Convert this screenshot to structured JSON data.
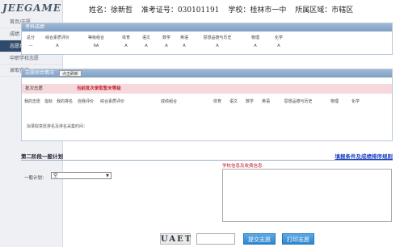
{
  "sidebar": {
    "logo": "JEEGAME",
    "items": [
      {
        "label": "首页/志愿"
      },
      {
        "label": "成绩"
      },
      {
        "label": "志愿填报"
      },
      {
        "label": "中职学校志愿"
      },
      {
        "label": "录取查询"
      }
    ],
    "active_index": 2
  },
  "student": {
    "name": "姓名：徐新哲",
    "ticket": "准考证号：030101191",
    "school": "学校：桂林市一中",
    "region": "所属区域：市辖区"
  },
  "scores": {
    "title": "考科成绩",
    "headers": [
      "总分",
      "综合素质评价",
      "等级组合",
      "体育",
      "语文",
      "数学",
      "英语",
      "思想品德与历史",
      "物理",
      "化学"
    ],
    "values": [
      "—",
      "A",
      "6A",
      "A",
      "A",
      "A",
      "A",
      "A",
      "A",
      "A"
    ]
  },
  "volunteer": {
    "title": "志愿综合情况",
    "refresh_button": "点击刷新",
    "plan_label": "批次志愿",
    "plan_status": "当前批次录取暂未等级",
    "headers": [
      "我的志愿",
      "指标",
      "我的排名",
      "自我评价",
      "综合素质评价",
      "成绩组合",
      "体育",
      "语文",
      "数学",
      "英语",
      "思想品德与历史",
      "物理",
      "化学"
    ],
    "note": "拟录取意愿排名及排名采集时间："
  },
  "phase2": {
    "title": "第二阶段一般计划",
    "link": "填报条件及成绩排序规则",
    "plan_field_label": "一般计划：",
    "plan_field_value": "空",
    "info_label": "学校信息及收费信息"
  },
  "footer": {
    "captcha": "UAET",
    "submit": "提交志愿",
    "print": "打印志愿"
  },
  "colors": {
    "header": "#8aa8cc",
    "accent_red": "#c02030",
    "button_blue": "#2f86cf",
    "sidebar_active": "#2f4a6a"
  }
}
